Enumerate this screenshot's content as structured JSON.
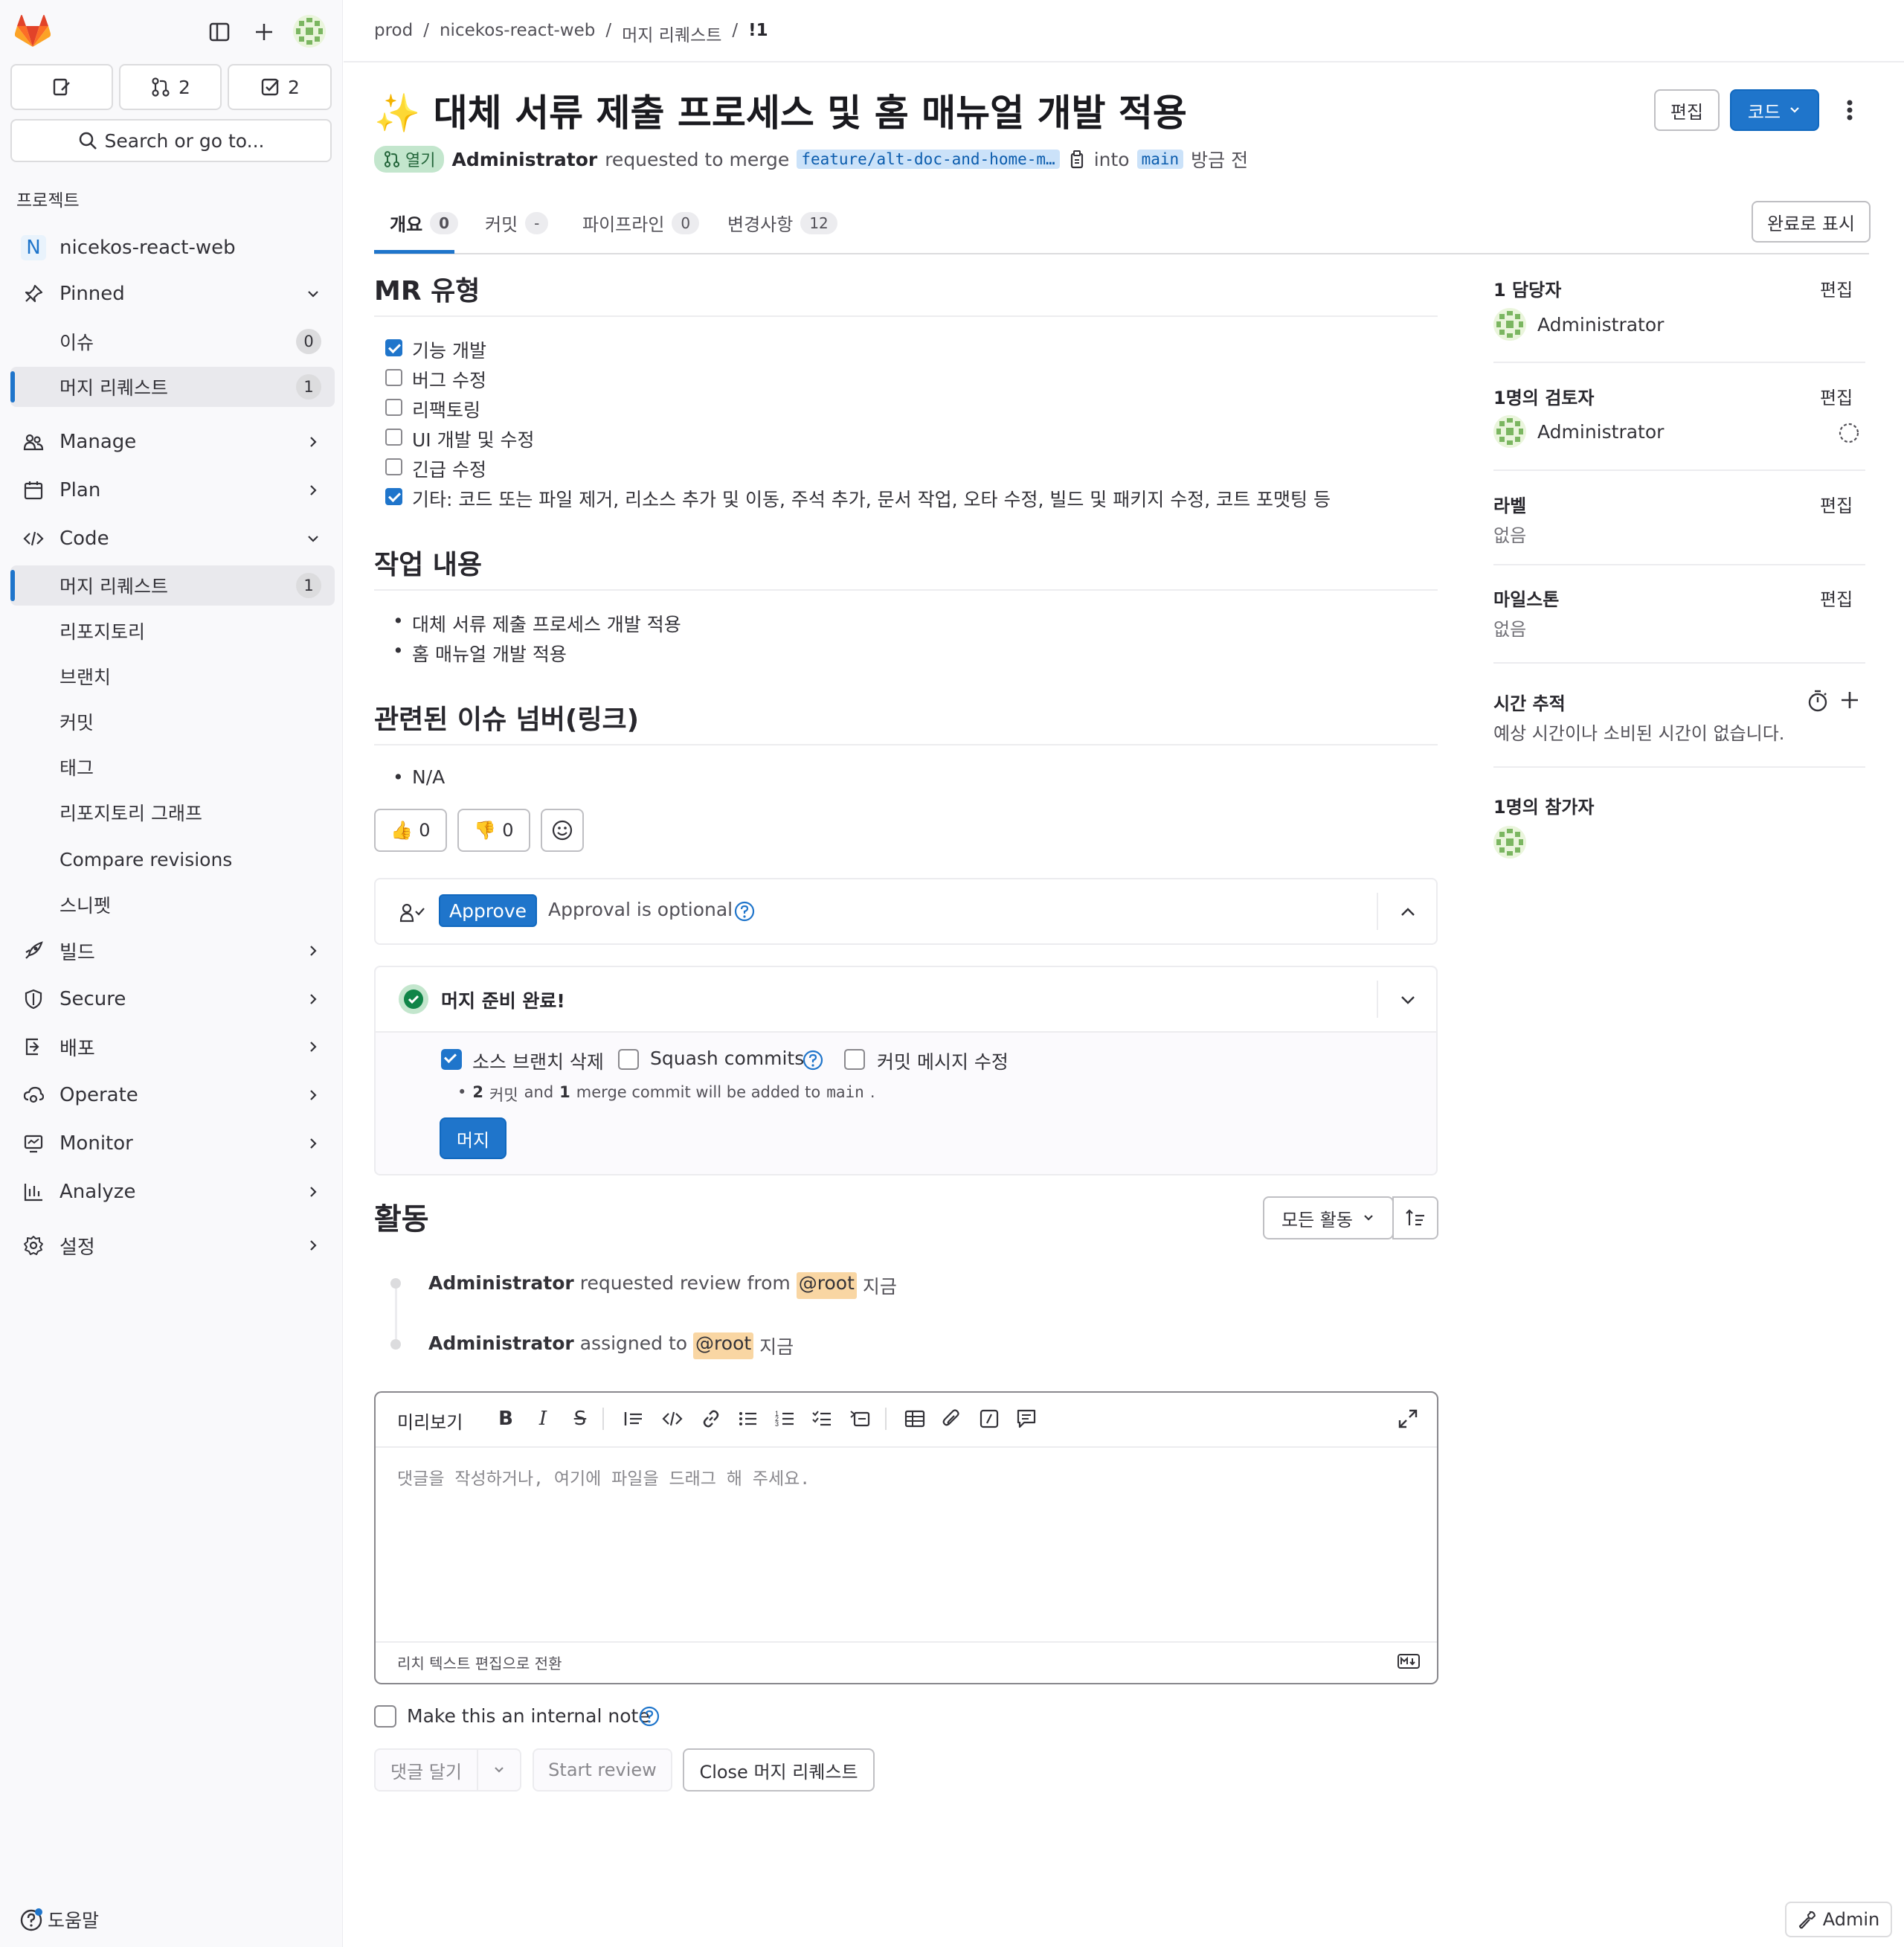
{
  "sidebar": {
    "search_label": "Search or go to...",
    "mr_count": "2",
    "todo_count": "2",
    "section_label": "프로젝트",
    "project_initial": "N",
    "project_name": "nicekos-react-web",
    "pinned": "Pinned",
    "pinned_items": [
      {
        "label": "이슈",
        "count": "0"
      },
      {
        "label": "머지 리퀘스트",
        "count": "1"
      }
    ],
    "manage": "Manage",
    "plan": "Plan",
    "code": "Code",
    "code_items": [
      {
        "label": "머지 리퀘스트",
        "count": "1"
      },
      {
        "label": "리포지토리"
      },
      {
        "label": "브랜치"
      },
      {
        "label": "커밋"
      },
      {
        "label": "태그"
      },
      {
        "label": "리포지토리 그래프"
      },
      {
        "label": "Compare revisions"
      },
      {
        "label": "스니펫"
      }
    ],
    "build": "빌드",
    "secure": "Secure",
    "deploy": "배포",
    "operate": "Operate",
    "monitor": "Monitor",
    "analyze": "Analyze",
    "settings": "설정",
    "help": "도움말"
  },
  "breadcrumb": [
    "prod",
    "nicekos-react-web",
    "머지 리퀘스트",
    "!1"
  ],
  "header": {
    "title": "✨ 대체 서류 제출 프로세스 및 홈 매뉴얼 개발 적용",
    "status": "열기",
    "author": "Administrator",
    "requested_text": "requested to merge",
    "source_branch": "feature/alt-doc-and-home-m…",
    "into": "into",
    "target_branch": "main",
    "time": "방금 전",
    "edit_button": "편집",
    "code_button": "코드",
    "mark_done_button": "완료로 표시"
  },
  "tabs": [
    {
      "label": "개요",
      "count": "0"
    },
    {
      "label": "커밋",
      "count": "-"
    },
    {
      "label": "파이프라인",
      "count": "0"
    },
    {
      "label": "변경사항",
      "count": "12"
    }
  ],
  "description": {
    "mr_type_heading": "MR 유형",
    "mr_types": [
      {
        "label": "기능 개발",
        "checked": true
      },
      {
        "label": "버그 수정",
        "checked": false
      },
      {
        "label": "리팩토링",
        "checked": false
      },
      {
        "label": "UI 개발 및 수정",
        "checked": false
      },
      {
        "label": "긴급 수정",
        "checked": false
      },
      {
        "label": "기타: 코드 또는 파일 제거, 리소스 추가 및 이동, 주석 추가, 문서 작업, 오타 수정, 빌드 및 패키지 수정, 코트 포맷팅 등",
        "checked": true
      }
    ],
    "work_heading": "작업 내용",
    "work_items": [
      "대체 서류 제출 프로세스 개발 적용",
      "홈 매뉴얼 개발 적용"
    ],
    "issue_heading": "관련된 이슈 넘버(링크)",
    "issue_items": [
      "N/A"
    ]
  },
  "reactions": {
    "thumbs_up": "0",
    "thumbs_down": "0"
  },
  "approval": {
    "button": "Approve",
    "text": "Approval is optional"
  },
  "merge": {
    "ready_text": "머지 준비 완료!",
    "delete_branch": "소스 브랜치 삭제",
    "squash": "Squash commits",
    "edit_message": "커밋 메시지 수정",
    "info_count": "2",
    "info_commits": "커밋",
    "info_and": "and",
    "info_merge_count": "1",
    "info_rest": "merge commit will be added to",
    "info_branch": "main",
    "merge_button": "머지"
  },
  "activity": {
    "heading": "활동",
    "filter": "모든 활동",
    "events": [
      {
        "user": "Administrator",
        "text": "requested review from",
        "mention": "@root",
        "time": "지금"
      },
      {
        "user": "Administrator",
        "text": "assigned to",
        "mention": "@root",
        "time": "지금"
      }
    ]
  },
  "editor": {
    "preview": "미리보기",
    "placeholder": "댓글을 작성하거나, 여기에 파일을 드래그 해 주세요.",
    "switch_rich": "리치 텍스트 편집으로 전환",
    "internal_note": "Make this an internal note",
    "comment_button": "댓글 달기",
    "start_review": "Start review",
    "close_button": "Close 머지 리퀘스트"
  },
  "right_sidebar": {
    "assignee_title": "1 담당자",
    "assignee": "Administrator",
    "reviewer_title": "1명의 검토자",
    "reviewer": "Administrator",
    "labels_title": "라벨",
    "labels_value": "없음",
    "milestone_title": "마일스톤",
    "milestone_value": "없음",
    "time_title": "시간 추적",
    "time_value": "예상 시간이나 소비된 시간이 없습니다.",
    "participants_title": "1명의 참가자",
    "edit": "편집"
  },
  "admin_button": "Admin",
  "colors": {
    "primary": "#1f75cb",
    "success": "#108548",
    "mention": "#f9d6a3"
  }
}
